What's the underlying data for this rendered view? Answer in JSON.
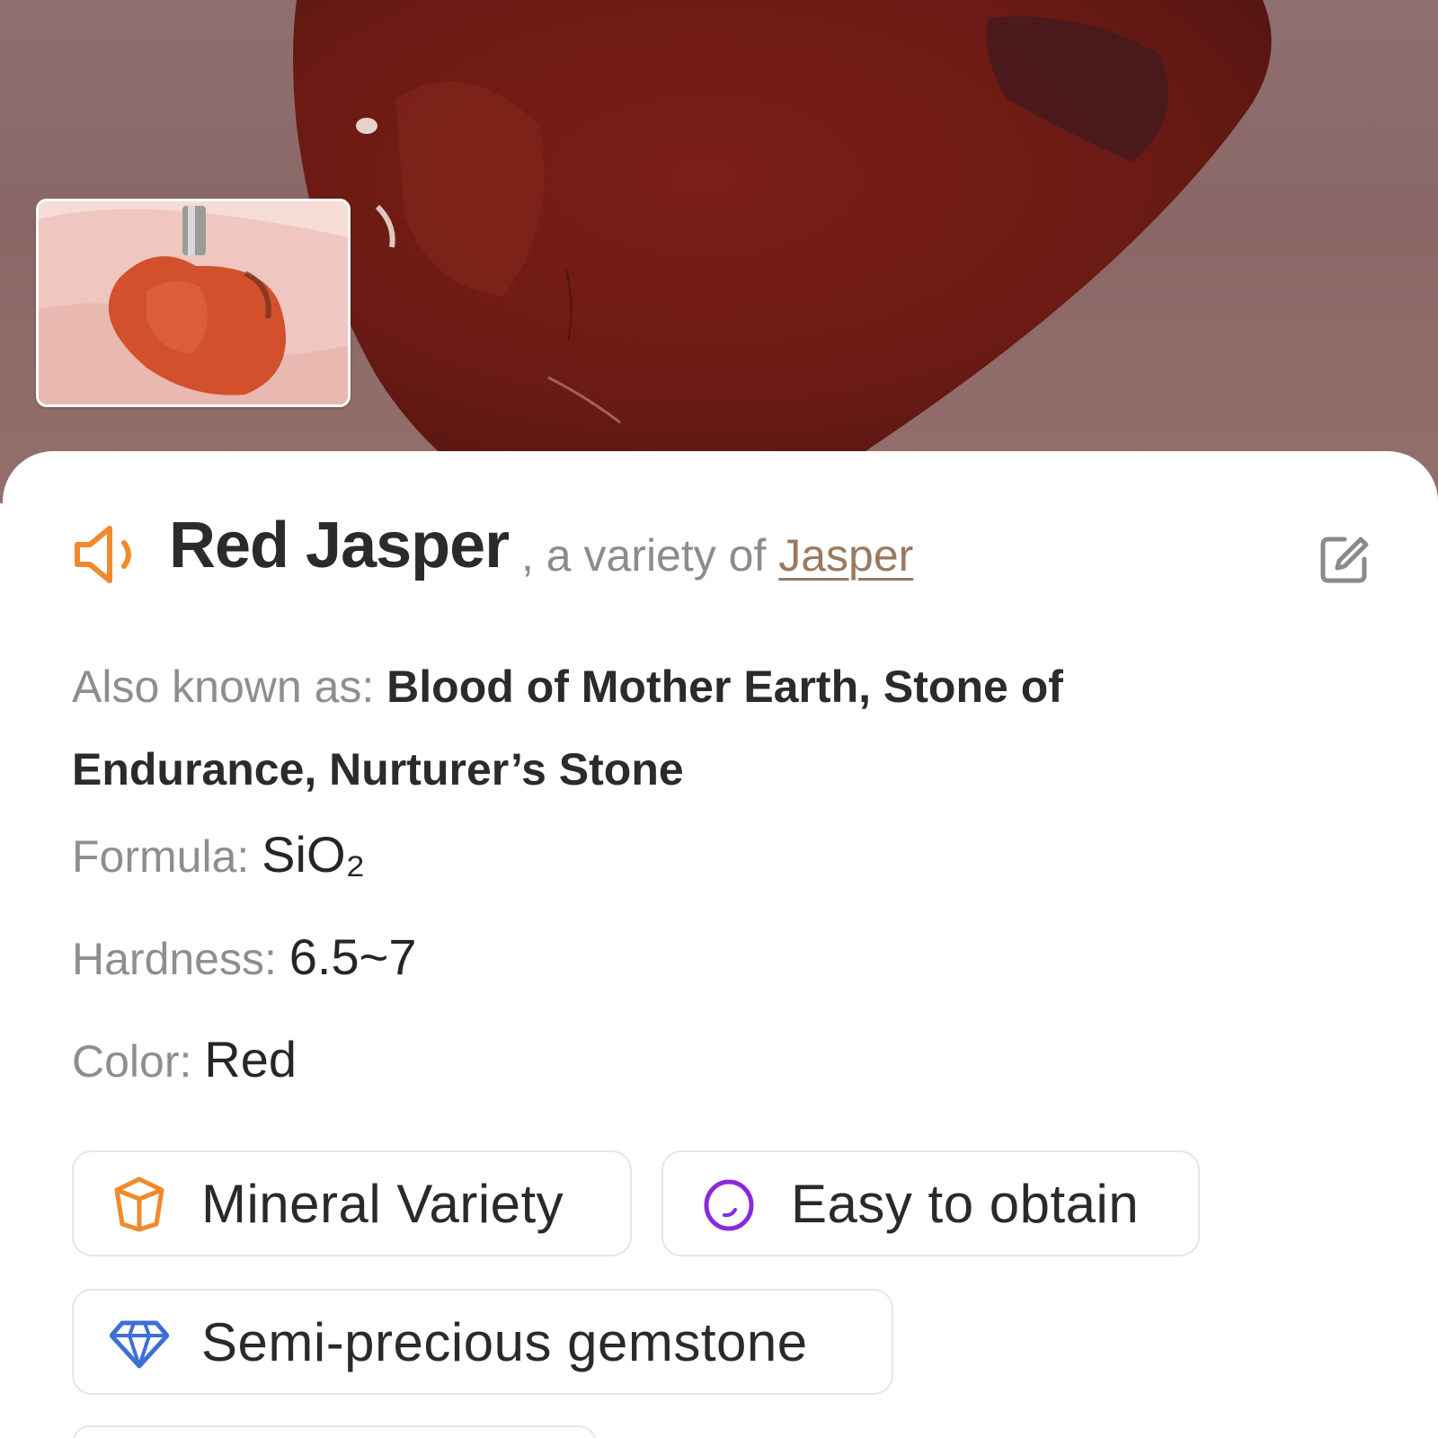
{
  "stone": {
    "name": "Red Jasper",
    "variety_prefix": ", a variety of ",
    "variety_link": "Jasper"
  },
  "properties": {
    "aka_label": "Also known as: ",
    "aka_value": "Blood of Mother Earth, Stone of Endurance, Nurturer’s Stone",
    "formula_label": "Formula: ",
    "formula_value": "SiO₂",
    "hardness_label": "Hardness: ",
    "hardness_value": "6.5~7",
    "color_label": "Color: ",
    "color_value": "Red"
  },
  "tags": [
    {
      "label": "Mineral Variety",
      "icon": "crystal-icon",
      "color": "#f08a2c"
    },
    {
      "label": "Easy to obtain",
      "icon": "circle-ring-icon",
      "color": "#8b2ad9"
    },
    {
      "label": "Semi-precious gemstone",
      "icon": "diamond-icon",
      "color": "#3d6fd6"
    }
  ],
  "icons": {
    "speaker": "speaker-icon",
    "edit": "edit-icon"
  },
  "colors": {
    "accent": "#f08a2c",
    "link": "#9a7a5f",
    "label": "#8e8e8e",
    "text": "#2b2b2b"
  }
}
